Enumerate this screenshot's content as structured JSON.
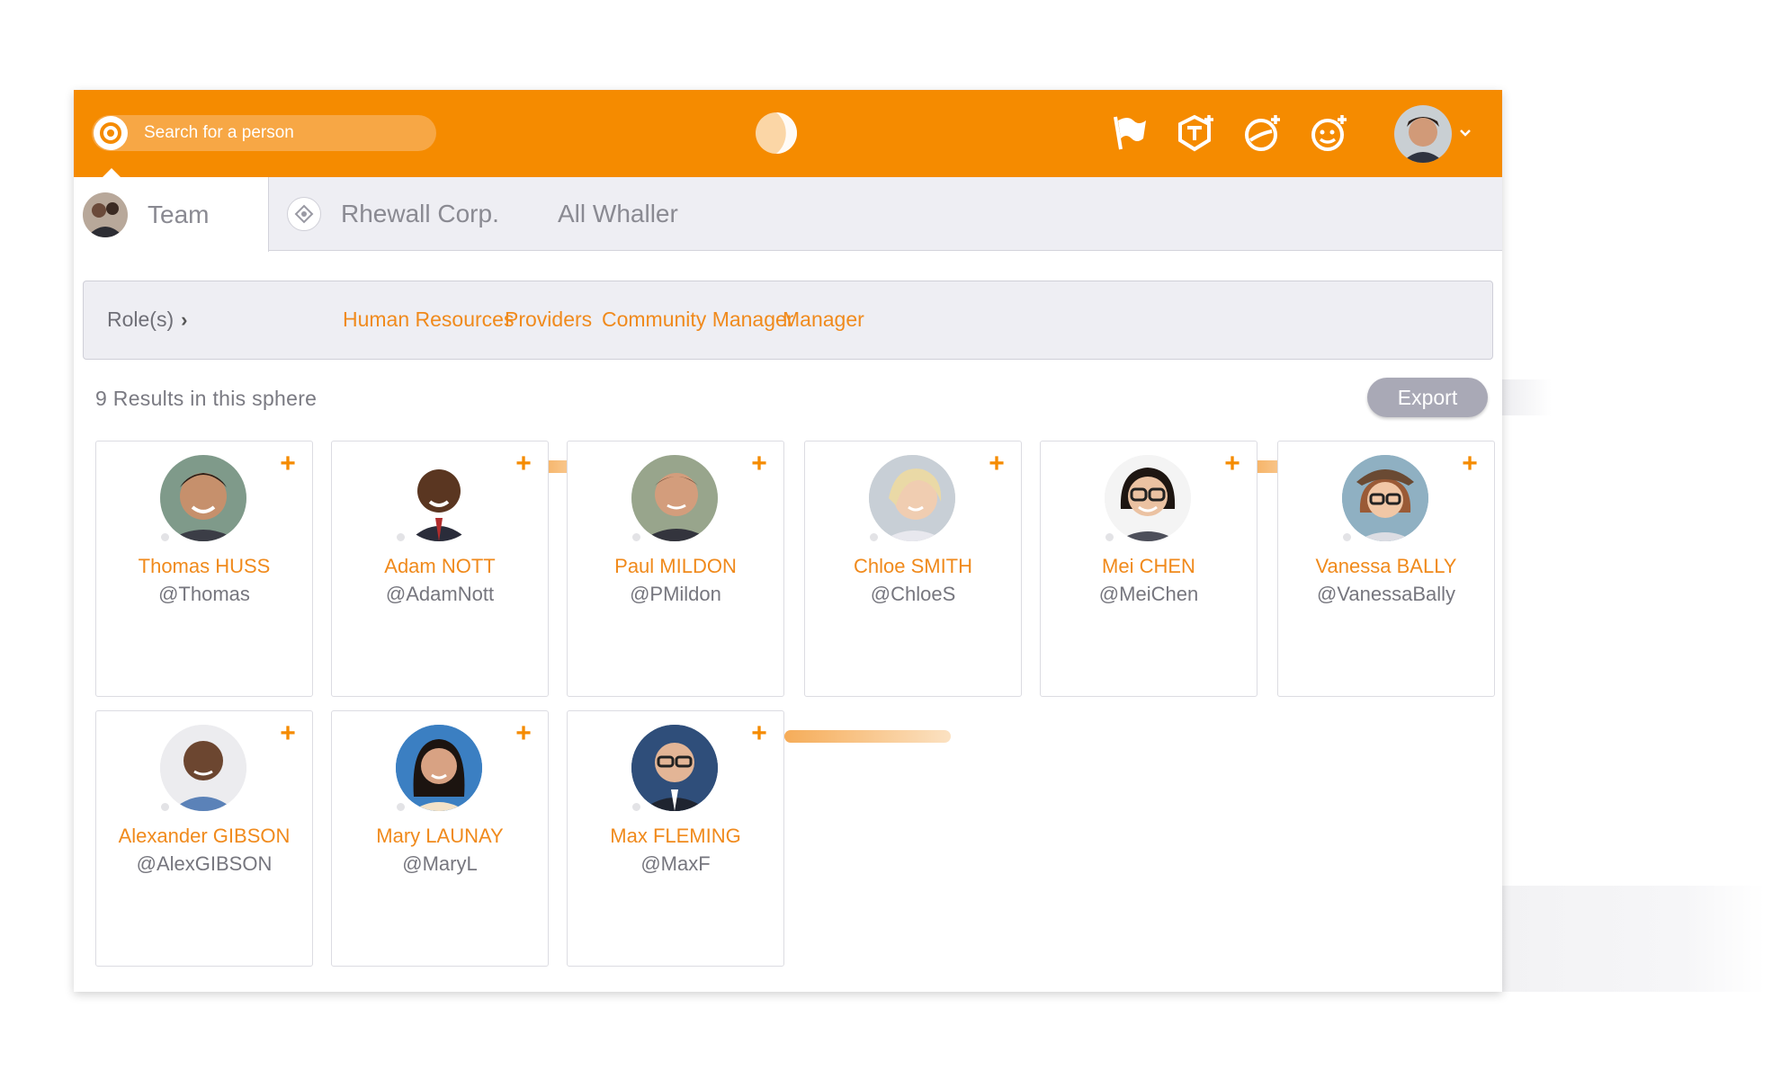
{
  "search": {
    "placeholder": "Search for a person"
  },
  "colors": {
    "brand": "#f58b00",
    "link": "#f08a1c",
    "muted_text": "#76767e",
    "tab_bg": "#eeeef3",
    "export_bg": "#a9a9b6"
  },
  "topbar": {
    "icons": [
      "flag-icon",
      "add-workspace-icon",
      "add-sphere-icon",
      "add-contact-icon"
    ],
    "user_menu_icon": "chevron-down-icon"
  },
  "tabs": {
    "active": {
      "label": "Team"
    },
    "items": [
      {
        "label": "Rhewall Corp."
      },
      {
        "label": "All Whaller"
      }
    ]
  },
  "filters": {
    "roles_label": "Role(s)",
    "items": [
      "Human Resources",
      "Providers",
      "Community Manager",
      "Manager"
    ]
  },
  "results_text": "9 Results in this sphere",
  "export_label": "Export",
  "add_label": "+",
  "people": [
    {
      "name": "Thomas HUSS",
      "handle": "@Thomas"
    },
    {
      "name": "Adam NOTT",
      "handle": "@AdamNott"
    },
    {
      "name": "Paul MILDON",
      "handle": "@PMildon"
    },
    {
      "name": "Chloe SMITH",
      "handle": "@ChloeS"
    },
    {
      "name": "Mei CHEN",
      "handle": "@MeiChen"
    },
    {
      "name": "Vanessa BALLY",
      "handle": "@VanessaBally"
    },
    {
      "name": "Alexander GIBSON",
      "handle": "@AlexGIBSON"
    },
    {
      "name": "Mary LAUNAY",
      "handle": "@MaryL"
    },
    {
      "name": "Max FLEMING",
      "handle": "@MaxF"
    }
  ]
}
